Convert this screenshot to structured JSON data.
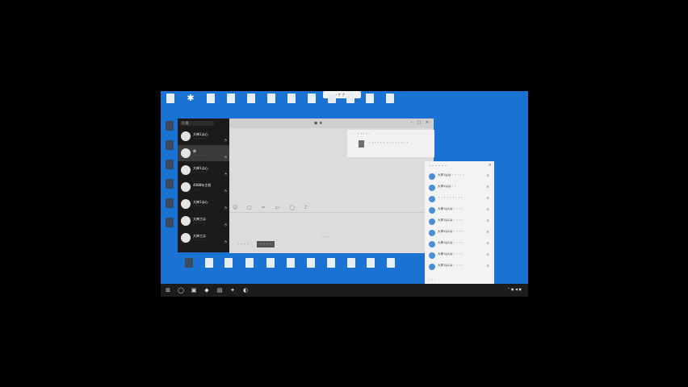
{
  "desktop": {
    "top_pill": "ナ・ナ ナ ・ナ",
    "top_row": [
      {
        "label": "",
        "icon": "recycle-bin-icon"
      },
      {
        "label": "",
        "icon": "star-icon"
      },
      {
        "label": "",
        "icon": "file-icon"
      },
      {
        "label": "",
        "icon": "file-icon"
      },
      {
        "label": "",
        "icon": "file-icon"
      },
      {
        "label": "",
        "icon": "file-icon"
      },
      {
        "label": "",
        "icon": "file-icon"
      },
      {
        "label": "",
        "icon": "file-icon"
      },
      {
        "label": "",
        "icon": "file-icon"
      },
      {
        "label": "",
        "icon": "file-icon"
      },
      {
        "label": "",
        "icon": "file-icon"
      },
      {
        "label": "",
        "icon": "file-icon"
      }
    ],
    "left_col": [
      {
        "label": "",
        "icon": "app-icon"
      },
      {
        "label": "",
        "icon": "app-icon"
      },
      {
        "label": "",
        "icon": "tool-icon"
      },
      {
        "label": "",
        "icon": "app-icon"
      },
      {
        "label": "",
        "icon": "app-icon"
      },
      {
        "label": "",
        "icon": "app-icon"
      }
    ],
    "bottom_row": [
      {
        "label": "",
        "icon": "app-icon"
      },
      {
        "label": "",
        "icon": "file-icon"
      },
      {
        "label": "",
        "icon": "file-icon"
      },
      {
        "label": "",
        "icon": "file-icon"
      },
      {
        "label": "",
        "icon": "file-icon"
      },
      {
        "label": "",
        "icon": "file-icon"
      },
      {
        "label": "",
        "icon": "file-icon"
      },
      {
        "label": "",
        "icon": "file-icon"
      },
      {
        "label": "",
        "icon": "file-icon"
      },
      {
        "label": "",
        "icon": "file-icon"
      },
      {
        "label": "",
        "icon": "file-icon"
      }
    ]
  },
  "chat": {
    "search_placeholder": "Q 搜",
    "title": "◉ ★",
    "window_controls": "– □ ×",
    "conversations": [
      {
        "name": "大神1は心",
        "time": "",
        "preview": "・・・・・",
        "active": false
      },
      {
        "name": "柴",
        "time": "",
        "preview": "・・・・・・",
        "active": true
      },
      {
        "name": "大神1は心",
        "time": "",
        "preview": "・・・・・・",
        "active": false
      },
      {
        "name": "4088年主祝",
        "time": "",
        "preview": "・・・・",
        "active": false
      },
      {
        "name": "大神1は心",
        "time": "",
        "preview": "・・・・・",
        "active": false
      },
      {
        "name": "大神工は",
        "time": "",
        "preview": "・・・・・",
        "active": false
      },
      {
        "name": "大神工は",
        "time": "",
        "preview": "・・・・・",
        "active": false
      }
    ],
    "toolbar": "☺ ▢ ✂ ▭ ◯ ♪",
    "input_info": "・・・・・",
    "send_hint": "・・・・",
    "send_label": "・・・・"
  },
  "popup": {
    "title": "・・・・・",
    "text": "・・・・・・ ・・・・・・・・"
  },
  "panel": {
    "header": "・・・・・・",
    "close": "×",
    "rows": [
      {
        "text": "大神1はは・・・・・"
      },
      {
        "text": "大神1はは・・"
      },
      {
        "text": "・・・・・・・・・"
      },
      {
        "text": "大神1は1は・・・・"
      },
      {
        "text": "大神1は1は・・・・"
      },
      {
        "text": "大神1は1は・・・・"
      },
      {
        "text": "大神1は1は・・・・"
      },
      {
        "text": "大神1は1は・・・・"
      },
      {
        "text": "大神1は1は・・・・"
      }
    ],
    "footer": "・・・"
  },
  "taskbar": {
    "buttons": [
      "⊞",
      "◯",
      "▣",
      "◆",
      "▤",
      "✦",
      "◐"
    ],
    "tray": "^ ▣ ◀ ▣",
    "clock_time": "",
    "clock_date": ""
  },
  "colors": {
    "desktop": "#1a73d2",
    "taskbar": "#1c1c1c",
    "chat_sidebar": "#1b1b1b",
    "chat_bg": "#dcdcdc"
  }
}
